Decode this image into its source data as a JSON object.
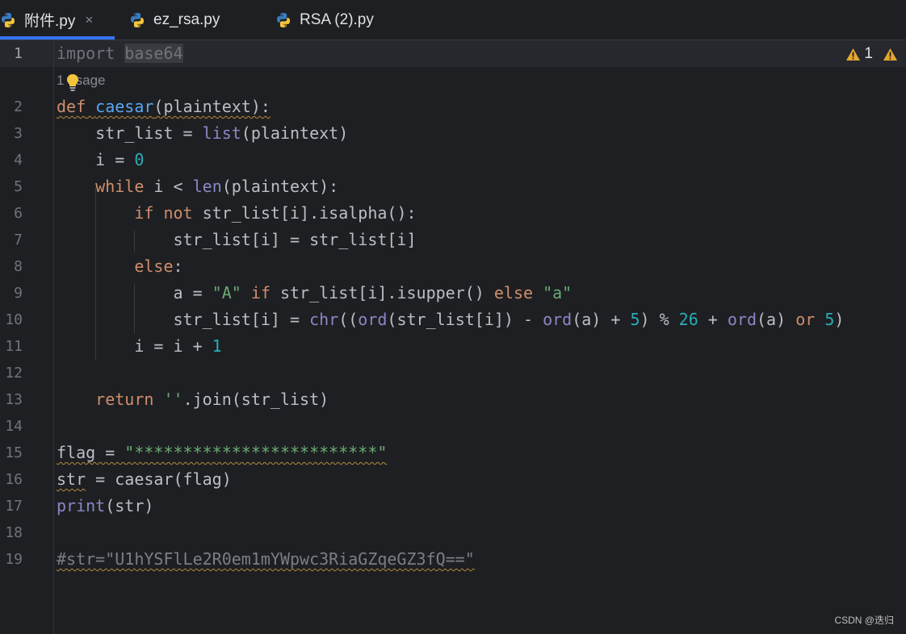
{
  "tabs": [
    {
      "label": "附件.py",
      "active": true,
      "closable": true,
      "icon": "python-icon"
    },
    {
      "label": "ez_rsa.py",
      "active": false,
      "icon": "python-icon"
    },
    {
      "label": "RSA (2).py",
      "active": false,
      "icon": "python-icon"
    }
  ],
  "tab_close_glyph": "×",
  "inspections": {
    "warning_count": "1",
    "icon": "warning-icon"
  },
  "usage_hint": "1 usage",
  "line_numbers": [
    "1",
    "2",
    "3",
    "4",
    "5",
    "6",
    "7",
    "8",
    "9",
    "10",
    "11",
    "12",
    "13",
    "14",
    "15",
    "16",
    "17",
    "18",
    "19"
  ],
  "code": {
    "l1": [
      "import",
      " ",
      "base64"
    ],
    "l2": [
      "def",
      " ",
      "caesar",
      "(plaintext):"
    ],
    "l3": [
      "    str_list = ",
      "list",
      "(plaintext)"
    ],
    "l4": [
      "    i = ",
      "0"
    ],
    "l5": [
      "    ",
      "while",
      " i < ",
      "len",
      "(plaintext):"
    ],
    "l6": [
      "        ",
      "if",
      " ",
      "not",
      " str_list[i].isalpha():"
    ],
    "l7": [
      "            str_list[i] = str_list[i]"
    ],
    "l8": [
      "        ",
      "else",
      ":"
    ],
    "l9": [
      "            a = ",
      "\"A\"",
      " ",
      "if",
      " str_list[i].isupper() ",
      "else",
      " ",
      "\"a\""
    ],
    "l10": [
      "            str_list[i] = ",
      "chr",
      "((",
      "ord",
      "(str_list[i]) - ",
      "ord",
      "(a) + ",
      "5",
      ") % ",
      "26",
      " + ",
      "ord",
      "(a) ",
      "or",
      " ",
      "5",
      ")"
    ],
    "l11": [
      "        i = i + ",
      "1"
    ],
    "l13": [
      "    ",
      "return",
      " ",
      "''",
      ".join(str_list)"
    ],
    "l15": [
      "flag = ",
      "\"*************************\""
    ],
    "l16": [
      "str",
      " = caesar(flag)"
    ],
    "l17": [
      "print",
      "(str)"
    ],
    "l19": [
      "#str=\"U1hYSFlLe2R0em1mYWpwc3RiaGZqeGZ3fQ==\""
    ]
  },
  "watermark": "CSDN @迭归",
  "colors": {
    "background": "#1e1f22",
    "keyword": "#cf8e6d",
    "function": "#56a8f5",
    "builtin": "#8888c6",
    "number": "#2aacb8",
    "string": "#6aab73",
    "comment": "#7a7e85",
    "text": "#bcbec4",
    "accent": "#3574f0"
  }
}
